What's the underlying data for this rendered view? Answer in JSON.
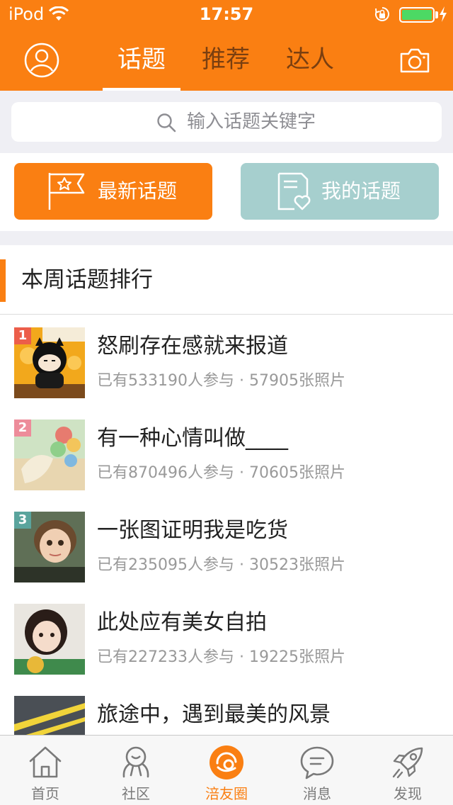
{
  "status_bar": {
    "carrier": "iPod",
    "time": "17:57",
    "battery_level": 1.0
  },
  "navbar": {
    "tabs": [
      {
        "label": "话题",
        "active": true
      },
      {
        "label": "推荐",
        "active": false
      },
      {
        "label": "达人",
        "active": false
      }
    ],
    "left_icon": "user-avatar-icon",
    "right_icon": "camera-icon"
  },
  "search": {
    "placeholder": "输入话题关键字"
  },
  "buttons": {
    "latest_label": "最新话题",
    "latest_icon": "star-flag-icon",
    "mine_label": "我的话题",
    "mine_icon": "document-heart-icon"
  },
  "section": {
    "title": "本周话题排行"
  },
  "topics": [
    {
      "rank": "1",
      "title": "怒刷存在感就来报道",
      "meta": "已有533190人参与 · 57905张照片"
    },
    {
      "rank": "2",
      "title": "有一种心情叫做____",
      "meta": "已有870496人参与 · 70605张照片"
    },
    {
      "rank": "3",
      "title": "一张图证明我是吃货",
      "meta": "已有235095人参与 · 30523张照片"
    },
    {
      "rank": "",
      "title": "此处应有美女自拍",
      "meta": "已有227233人参与 · 19225张照片"
    },
    {
      "rank": "",
      "title": "旅途中，遇到最美的风景",
      "meta": ""
    }
  ],
  "tabbar": {
    "items": [
      {
        "label": "首页",
        "icon": "home-icon",
        "active": false
      },
      {
        "label": "社区",
        "icon": "community-icon",
        "active": false
      },
      {
        "label": "涪友圈",
        "icon": "friends-circle-icon",
        "active": true
      },
      {
        "label": "消息",
        "icon": "message-icon",
        "active": false
      },
      {
        "label": "发现",
        "icon": "rocket-icon",
        "active": false
      }
    ]
  },
  "colors": {
    "brand_orange": "#fa7f12",
    "teal_button": "#a6cfce",
    "background_gray": "#efeff4"
  }
}
